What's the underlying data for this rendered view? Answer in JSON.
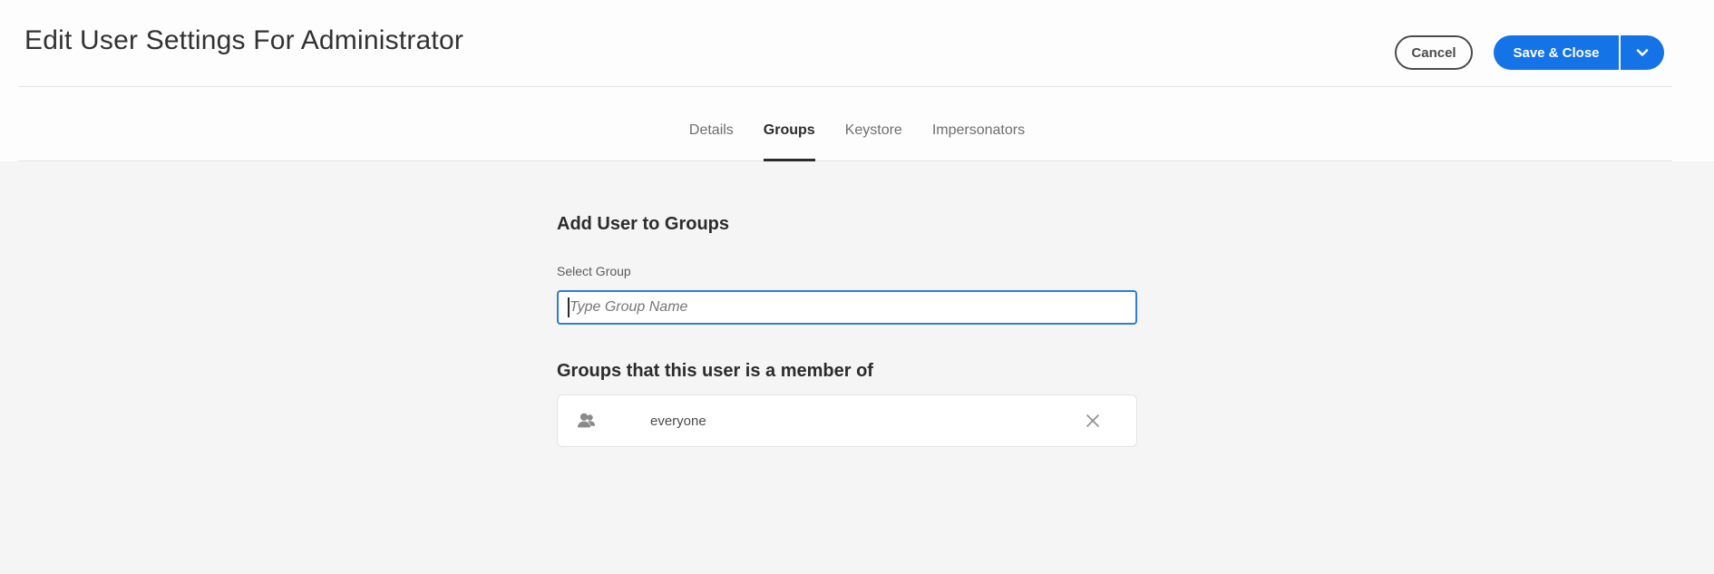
{
  "colors": {
    "accent_blue": "#1473E6",
    "input_focus_border": "#2d7dd2",
    "active_tab": "#2c2c2c"
  },
  "header": {
    "title": "Edit User Settings For Administrator",
    "cancel_label": "Cancel",
    "save_label": "Save & Close",
    "save_more_icon": "chevron-down"
  },
  "tabs": [
    {
      "label": "Details",
      "active": false
    },
    {
      "label": "Groups",
      "active": true
    },
    {
      "label": "Keystore",
      "active": false
    },
    {
      "label": "Impersonators",
      "active": false
    }
  ],
  "content": {
    "add_heading": "Add User to Groups",
    "select_group_label": "Select Group",
    "group_input_value": "",
    "group_input_placeholder": "Type Group Name",
    "member_heading": "Groups that this user is a member of",
    "groups": [
      {
        "name": "everyone",
        "icon": "user-group",
        "remove_icon": "close-x"
      }
    ]
  }
}
